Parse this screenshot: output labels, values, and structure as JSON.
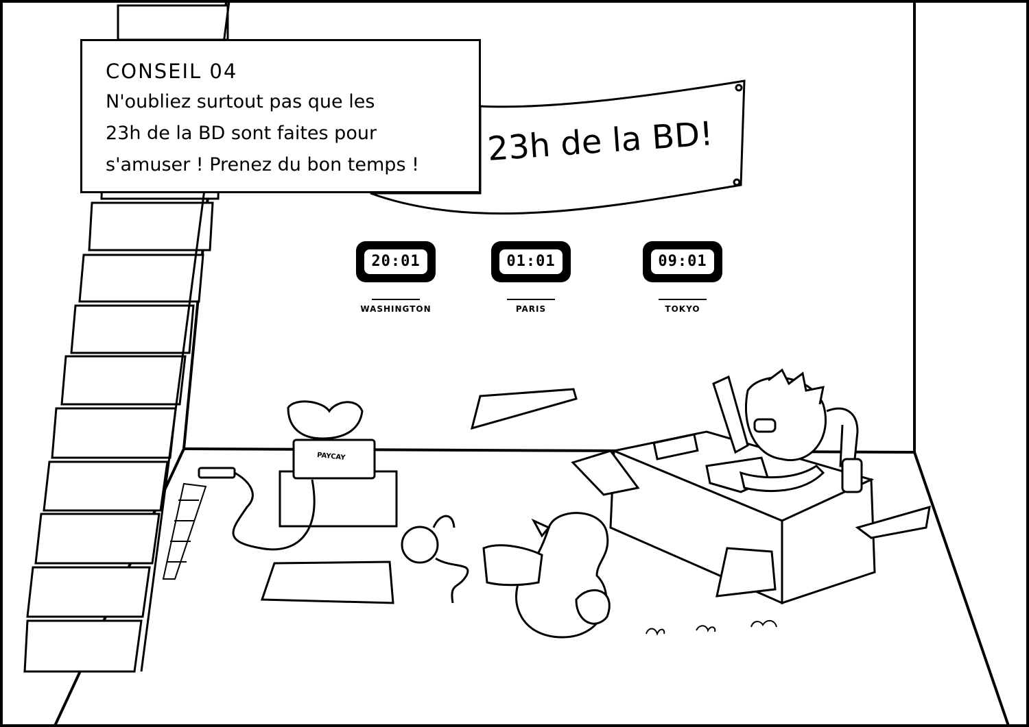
{
  "caption": {
    "title": "CONSEIL 04",
    "lines": [
      "N'oubliez surtout pas que les",
      "23h de la BD sont faites pour",
      "s'amuser ! Prenez du bon temps !"
    ]
  },
  "banner": {
    "text": "23h de la BD!"
  },
  "clocks": [
    {
      "time": "20:01",
      "label": "WASHINGTON"
    },
    {
      "time": "01:01",
      "label": "PARIS"
    },
    {
      "time": "09:01",
      "label": "TOKYO"
    }
  ],
  "laptop": {
    "sticker": "PAYCAY"
  },
  "colors": {
    "ink": "#000000",
    "paper": "#ffffff"
  }
}
